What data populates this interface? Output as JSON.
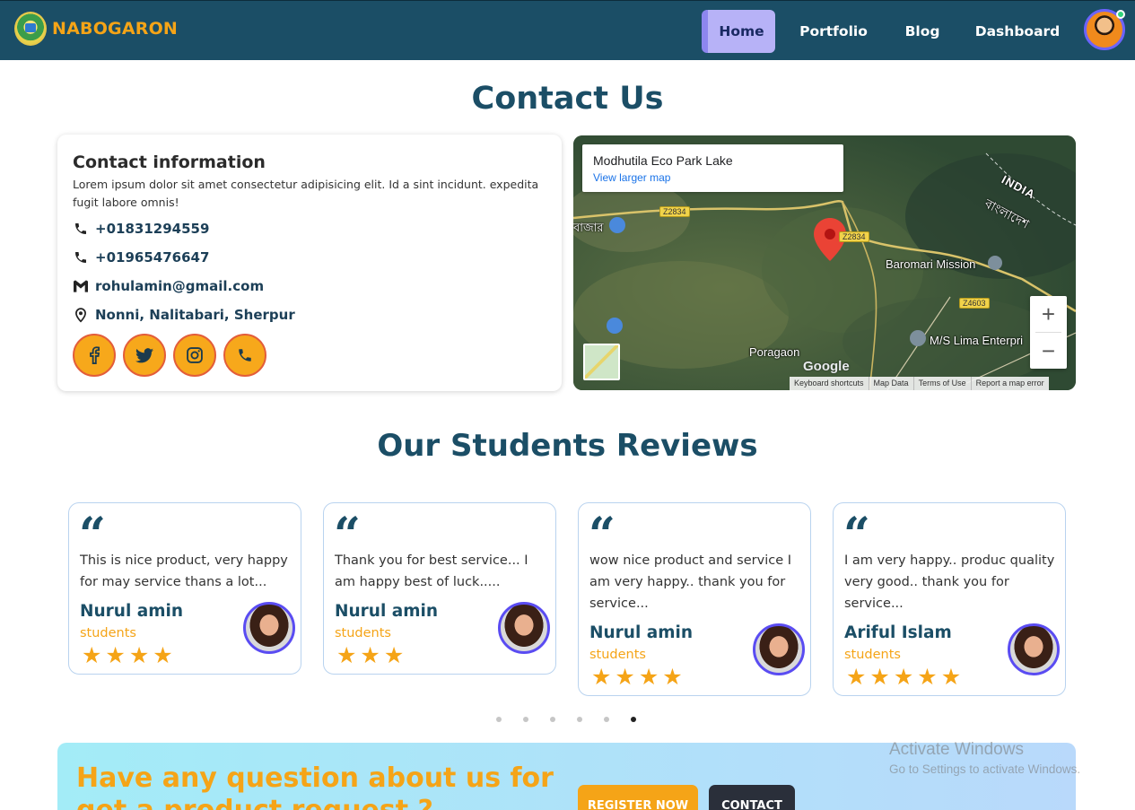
{
  "navbar": {
    "brand": "NABOGARON",
    "links": [
      "Home",
      "Portfolio",
      "Blog",
      "Dashboard"
    ],
    "active": "Home"
  },
  "contact": {
    "title": "Contact Us",
    "heading": "Contact information",
    "description": "Lorem ipsum dolor sit amet consectetur adipisicing elit. Id a sint incidunt. expedita fugit labore omnis!",
    "phone1": "+01831294559",
    "phone2": "+01965476647",
    "email": "rohulamin@gmail.com",
    "address": "Nonni, Nalitabari, Sherpur",
    "social_icons": [
      "facebook-icon",
      "twitter-icon",
      "instagram-icon",
      "phone-icon"
    ]
  },
  "map": {
    "place": "Modhutila Eco Park Lake",
    "view_larger": "View larger map",
    "labels": {
      "bazar": "বাজার",
      "india": "INDIA",
      "india_bn": "বাংলাদেশ",
      "baromari": "Baromari Mission",
      "ms_lima": "M/S Lima Enterpri",
      "poragaon": "Poragaon"
    },
    "roads": [
      "Z2834",
      "Z2834",
      "Z4603"
    ],
    "google": "Google",
    "footer": [
      "Keyboard shortcuts",
      "Map Data",
      "Terms of Use",
      "Report a map error"
    ]
  },
  "reviews": {
    "title": "Our Students Reviews",
    "items": [
      {
        "text": "This is nice product, very happy for may service thans a lot...",
        "name": "Nurul amin",
        "role": "students",
        "stars": 4
      },
      {
        "text": "Thank you for best service... I am happy best of luck.....",
        "name": "Nurul amin",
        "role": "students",
        "stars": 3
      },
      {
        "text": "wow nice product and service I am very happy.. thank you for service...",
        "name": "Nurul amin",
        "role": "students",
        "stars": 4
      },
      {
        "text": "I am very happy.. produc quality very good.. thank you for service...",
        "name": "Ariful Islam",
        "role": "students",
        "stars": 5
      }
    ],
    "dots": 6,
    "active_dot": 6
  },
  "cta": {
    "title": "Have any question about us for get a product request ?",
    "register": "REGISTER NOW",
    "contact": "CONTACT"
  },
  "watermark": {
    "title": "Activate Windows",
    "subtitle": "Go to Settings to activate Windows."
  },
  "colors": {
    "navbar": "#1b4e66",
    "accent": "#f5a417",
    "heading": "#1b4e66",
    "active_nav": "#b7b2f7"
  }
}
